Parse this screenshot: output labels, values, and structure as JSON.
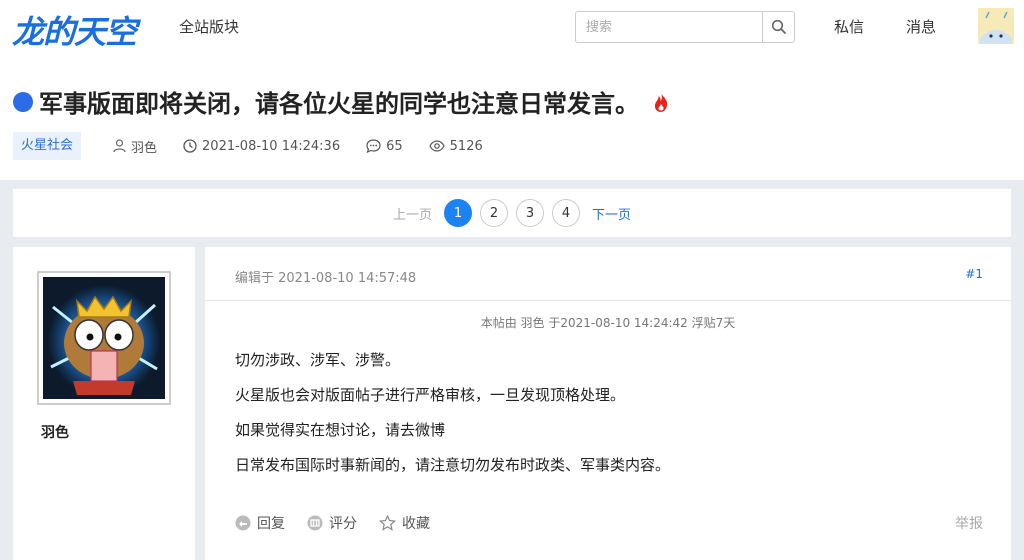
{
  "header": {
    "logo": "龙的天空",
    "nav_all": "全站版块",
    "search_placeholder": "搜索",
    "nav_pm": "私信",
    "nav_msg": "消息"
  },
  "thread": {
    "title": "军事版面即将关闭，请各位火星的同学也注意日常发言。",
    "tag": "火星社会",
    "author": "羽色",
    "time": "2021-08-10 14:24:36",
    "replies": "65",
    "views": "5126"
  },
  "pager": {
    "prev": "上一页",
    "pages": [
      "1",
      "2",
      "3",
      "4"
    ],
    "next": "下一页"
  },
  "post": {
    "username": "羽色",
    "edited": "编辑于 2021-08-10 14:57:48",
    "floor": "#1",
    "note": "本帖由 羽色 于2021-08-10 14:24:42 浮贴7天",
    "lines": [
      "切勿涉政、涉军、涉警。",
      "火星版也会对版面帖子进行严格审核，一旦发现顶格处理。",
      "如果觉得实在想讨论，请去微博",
      "日常发布国际时事新闻的，请注意切勿发布时政类、军事类内容。"
    ],
    "actions": {
      "reply": "回复",
      "rate": "评分",
      "fav": "收藏",
      "report": "举报"
    }
  },
  "colors": {
    "accent": "#1c83f3",
    "link": "#1a6fe0",
    "title_dot": "#2e6be6",
    "flame": "#e8231a"
  }
}
